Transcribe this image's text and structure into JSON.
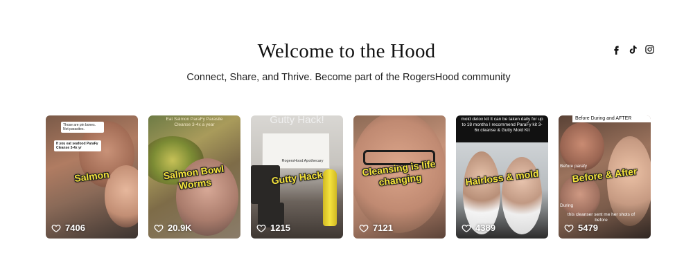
{
  "header": {
    "title": "Welcome to the Hood",
    "subtitle": "Connect, Share, and Thrive. Become part of the RogersHood community"
  },
  "social": [
    "facebook-icon",
    "tiktok-icon",
    "instagram-icon"
  ],
  "cards": [
    {
      "caption": "Salmon",
      "likes": "7406",
      "overlay_notes": [
        "Those are pin bones. Not parasites.",
        "If you eat seafood ParaFy Cleanse 3-4x yr"
      ]
    },
    {
      "caption": "Salmon Bowl Worms",
      "likes": "20.9K",
      "overlay_top": "Eat Salmon ParaFy Parasite Cleanse 3-4x a year"
    },
    {
      "caption": "Gutty Hack",
      "likes": "1215",
      "overlay_top": "Gutty Hack!",
      "box_label": "RogersHood Apothecary"
    },
    {
      "caption": "Cleansing is life changing",
      "likes": "7121"
    },
    {
      "caption": "Hairloss & mold",
      "likes": "4389",
      "overlay_top": "mold detox kit It can be taken daily for up to 18 months I recommend ParaFy kit 3-6x cleanse & Gutty Mold Kit"
    },
    {
      "caption": "Before & After",
      "likes": "5479",
      "overlay_top": "Before During and AFTER",
      "overlay_bottom": "this cleanser sent me her shots of before",
      "side_labels": [
        "Before parafy",
        "During"
      ]
    }
  ]
}
